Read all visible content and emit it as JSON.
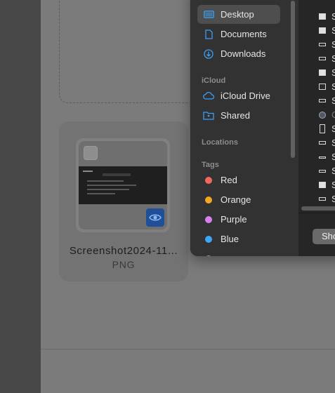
{
  "upload": {
    "file_name": "Screenshot2024-11...",
    "file_type": "PNG"
  },
  "finder": {
    "favorites": [
      {
        "label": "Desktop",
        "icon": "desktop-icon",
        "selected": true
      },
      {
        "label": "Documents",
        "icon": "document-icon",
        "selected": false
      },
      {
        "label": "Downloads",
        "icon": "download-icon",
        "selected": false
      }
    ],
    "icloud_header": "iCloud",
    "icloud": [
      {
        "label": "iCloud Drive",
        "icon": "cloud-icon"
      },
      {
        "label": "Shared",
        "icon": "shared-folder-icon"
      }
    ],
    "locations_header": "Locations",
    "tags_header": "Tags",
    "tags": [
      {
        "label": "Red",
        "color": "#f2685f"
      },
      {
        "label": "Orange",
        "color": "#f5a623"
      },
      {
        "label": "Purple",
        "color": "#d87ff0"
      },
      {
        "label": "Blue",
        "color": "#3ea7f5"
      }
    ],
    "file_rows": [
      "S",
      "S",
      "S",
      "S",
      "S",
      "S",
      "S",
      "C",
      "S",
      "S",
      "S",
      "S",
      "S",
      "S"
    ],
    "show_button": "Sho"
  },
  "colors": {
    "accent": "#3b9ef5",
    "preview_button": "#1e4f97"
  }
}
